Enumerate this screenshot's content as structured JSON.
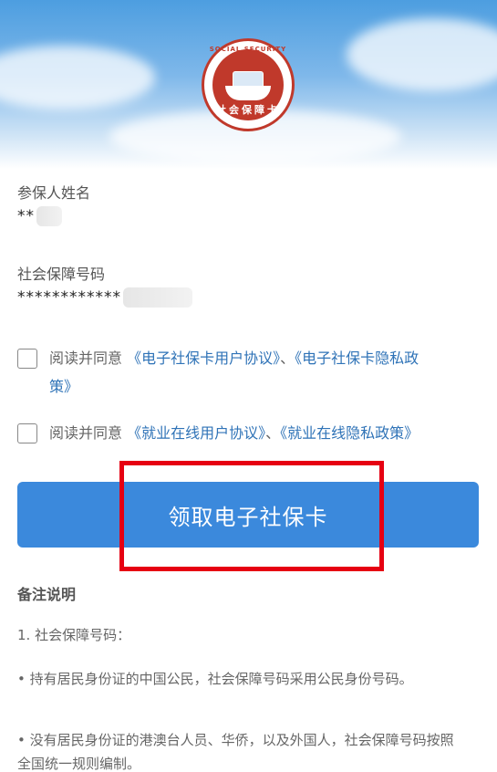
{
  "header": {
    "logo_arc_text": "SOCIAL SECURITY CARD",
    "logo_cn_text": "社会保障卡"
  },
  "insured_name": {
    "label": "参保人姓名",
    "value": "**"
  },
  "ssn": {
    "label": "社会保障号码",
    "value": "************"
  },
  "agreements": [
    {
      "prefix": "阅读并同意",
      "link1": "《电子社保卡用户协议》",
      "separator": "、",
      "link2_line1": "《电子社保卡隐私政",
      "link2_line2": "策》"
    },
    {
      "prefix": "阅读并同意",
      "link1": "《就业在线用户协议》",
      "separator": "、",
      "link2": "《就业在线隐私政策》"
    }
  ],
  "cta_label": "领取电子社保卡",
  "notes": {
    "title": "备注说明",
    "item1": "1. 社会保障号码：",
    "bullet1": "• 持有居民身份证的中国公民，社会保障号码采用公民身份号码。",
    "bullet2": "• 没有居民身份证的港澳台人员、华侨，以及外国人，社会保障号码按照全国统一规则编制。"
  },
  "colors": {
    "accent": "#3b89dc",
    "link": "#2f73b7",
    "highlight": "#e60012",
    "logo_red": "#c0392b"
  }
}
